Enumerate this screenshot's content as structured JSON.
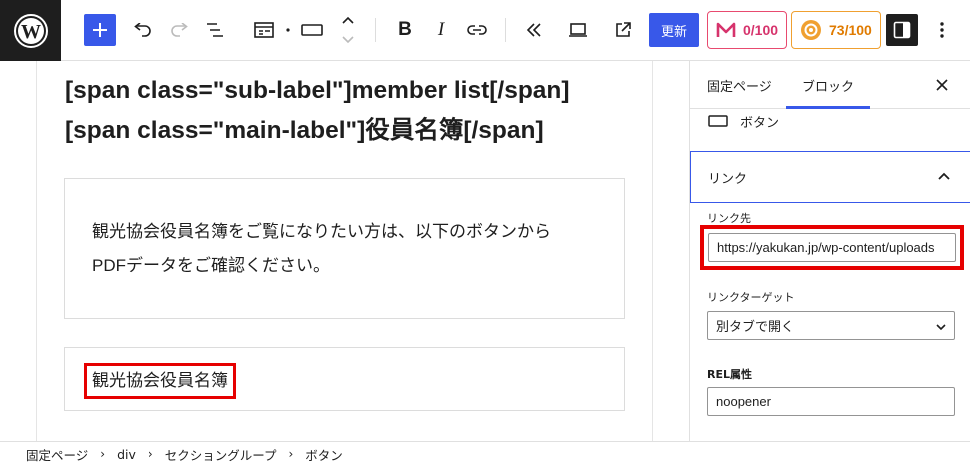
{
  "toolbar": {
    "update_label": "更新",
    "score1": "0/100",
    "score2": "73/100",
    "colors": {
      "accent": "#3858e9",
      "score1": "#d6336c",
      "score2": "#e07b00",
      "highlight": "#e60000"
    }
  },
  "canvas": {
    "heading_line1": "[span class=\"sub-label\"]member list[/span]",
    "heading_line2": "[span class=\"main-label\"]役員名簿[/span]",
    "paragraph_line1": "観光協会役員名簿をご覧になりたい方は、以下のボタンから",
    "paragraph_line2": "PDFデータをご確認ください。",
    "button_text": "観光協会役員名簿"
  },
  "sidebar": {
    "tab_page": "固定ページ",
    "tab_block": "ブロック",
    "block_name": "ボタン",
    "panel_title": "リンク",
    "link_label": "リンク先",
    "link_value": "https://yakukan.jp/wp-content/uploads",
    "target_label": "リンクターゲット",
    "target_value": "別タブで開く",
    "rel_label": "REL属性",
    "rel_value": "noopener"
  },
  "breadcrumb": {
    "items": [
      "固定ページ",
      "div",
      "セクショングループ",
      "ボタン"
    ]
  }
}
